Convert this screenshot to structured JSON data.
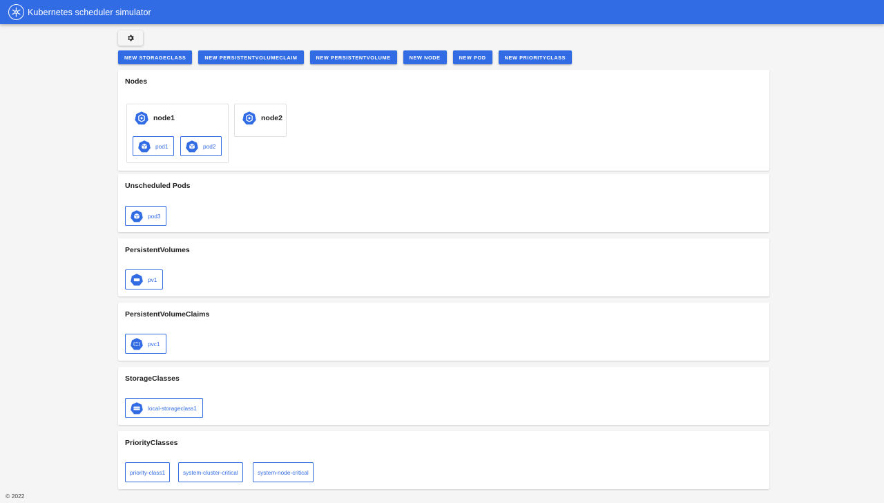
{
  "app": {
    "title": "Kubernetes scheduler simulator"
  },
  "toolbar": {
    "settings_icon": "gear-icon",
    "buttons": [
      "NEW STORAGECLASS",
      "NEW PERSISTENTVOLUMECLAIM",
      "NEW PERSISTENTVOLUME",
      "NEW NODE",
      "NEW POD",
      "NEW PRIORITYCLASS"
    ]
  },
  "sections": {
    "nodes": {
      "title": "Nodes",
      "items": [
        {
          "name": "node1",
          "pods": [
            "pod1",
            "pod2"
          ]
        },
        {
          "name": "node2",
          "pods": []
        }
      ]
    },
    "unscheduled_pods": {
      "title": "Unscheduled Pods",
      "items": [
        "pod3"
      ]
    },
    "persistent_volumes": {
      "title": "PersistentVolumes",
      "items": [
        "pv1"
      ]
    },
    "persistent_volume_claims": {
      "title": "PersistentVolumeClaims",
      "items": [
        "pvc1"
      ]
    },
    "storage_classes": {
      "title": "StorageClasses",
      "items": [
        "local-storageclass1"
      ]
    },
    "priority_classes": {
      "title": "PriorityClasses",
      "items": [
        "priority-class1",
        "system-cluster-critical",
        "system-node-critical"
      ]
    }
  },
  "footer": {
    "text": "© 2022"
  },
  "colors": {
    "primary": "#326ce5",
    "background": "#f5f5f5",
    "card": "#ffffff"
  }
}
